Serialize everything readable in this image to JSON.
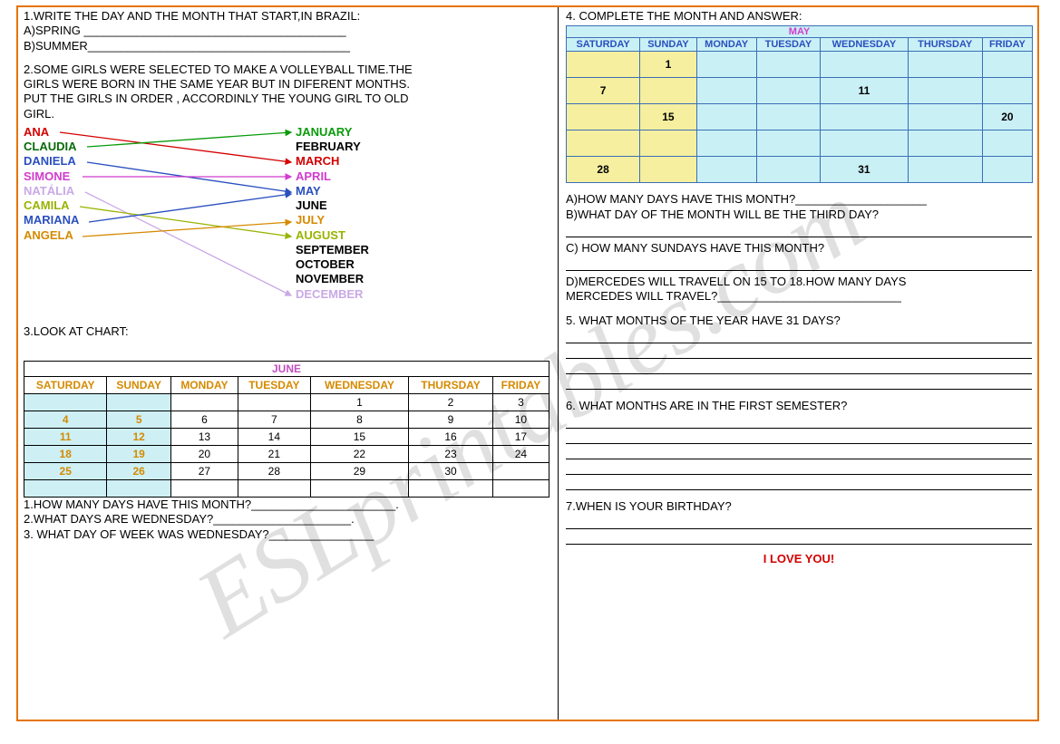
{
  "watermark": "ESLprintables.com",
  "left": {
    "q1": "1.WRITE THE DAY AND THE MONTH THAT START,IN BRAZIL:",
    "q1a": "A)SPRING ________________________________________",
    "q1b": "B)SUMMER________________________________________",
    "q2l1": "2.SOME GIRLS WERE SELECTED TO MAKE A VOLLEYBALL TIME.THE",
    "q2l2": "GIRLS WERE BORN IN THE SAME YEAR BUT IN DIFERENT MONTHS.",
    "q2l3": "PUT  THE GIRLS  IN ORDER , ACCORDINLY   THE YOUNG  GIRL TO OLD",
    "q2l4": "GIRL.",
    "names": [
      {
        "t": "ANA",
        "c": "#d40000"
      },
      {
        "t": "CLAUDIA",
        "c": "#0a6b0a"
      },
      {
        "t": "DANIELA",
        "c": "#2a4fbf"
      },
      {
        "t": "SIMONE",
        "c": "#d23ccf"
      },
      {
        "t": "NATÁLIA",
        "c": "#c9a9e6"
      },
      {
        "t": "CAMILA",
        "c": "#99b300"
      },
      {
        "t": "MARIANA",
        "c": "#2a4fbf"
      },
      {
        "t": "ANGELA",
        "c": "#d58a00"
      }
    ],
    "months12": [
      {
        "t": "JANUARY",
        "c": "#0a9b0a"
      },
      {
        "t": "FEBRUARY",
        "c": "#000"
      },
      {
        "t": "MARCH",
        "c": "#d40000"
      },
      {
        "t": "APRIL",
        "c": "#d23ccf"
      },
      {
        "t": "MAY",
        "c": "#2a4fbf"
      },
      {
        "t": "JUNE",
        "c": "#000"
      },
      {
        "t": "JULY",
        "c": "#d58a00"
      },
      {
        "t": "AUGUST",
        "c": "#99b300"
      },
      {
        "t": "SEPTEMBER",
        "c": "#000"
      },
      {
        "t": "OCTOBER",
        "c": "#000"
      },
      {
        "t": "NOVEMBER",
        "c": "#000"
      },
      {
        "t": "DECEMBER",
        "c": "#c9a9e6"
      }
    ],
    "q3": "3.LOOK AT CHART:",
    "june": {
      "title": "JUNE",
      "hdr": [
        "SATURDAY",
        "SUNDAY",
        "MONDAY",
        "TUESDAY",
        "WEDNESDAY",
        "THURSDAY",
        "FRIDAY"
      ],
      "rows": [
        [
          "",
          "",
          "",
          "",
          "1",
          "2",
          "3"
        ],
        [
          "4",
          "5",
          "6",
          "7",
          "8",
          "9",
          "10"
        ],
        [
          "11",
          "12",
          "13",
          "14",
          "15",
          "16",
          "17"
        ],
        [
          "18",
          "19",
          "20",
          "21",
          "22",
          "23",
          "24"
        ],
        [
          "25",
          "26",
          "27",
          "28",
          "29",
          "30",
          ""
        ],
        [
          "",
          "",
          "",
          "",
          "",
          "",
          ""
        ]
      ]
    },
    "q3a": "1.HOW MANY DAYS  HAVE THIS MONTH?______________________.",
    "q3b": "2.WHAT DAYS ARE WEDNESDAY?_____________________.",
    "q3c": "3. WHAT DAY OF WEEK WAS WEDNESDAY?________________"
  },
  "right": {
    "q4": "4. COMPLETE THE MONTH AND ANSWER:",
    "may": {
      "title": "MAY",
      "hdr": [
        "SATURDAY",
        "SUNDAY",
        "MONDAY",
        "TUESDAY",
        "WEDNESDAY",
        "THURSDAY",
        "FRIDAY"
      ],
      "rows": [
        [
          "",
          "1",
          "",
          "",
          "",
          "",
          ""
        ],
        [
          "7",
          "",
          "",
          "",
          "11",
          "",
          ""
        ],
        [
          "",
          "15",
          "",
          "",
          "",
          "",
          "20"
        ],
        [
          "",
          "",
          "",
          "",
          "",
          "",
          ""
        ],
        [
          "28",
          "",
          "",
          "",
          "31",
          "",
          ""
        ]
      ]
    },
    "q4a": "A)HOW MANY DAYS HAVE THIS MONTH?____________________",
    "q4b": "B)WHAT DAY OF THE MONTH WILL BE THE THIRD DAY?",
    "q4c": "C) HOW MANY SUNDAYS HAVE THIS MONTH?",
    "q4d1": "D)MERCEDES WILL TRAVELL  ON 15 TO 18.HOW MANY DAYS",
    "q4d2": "MERCEDES WILL TRAVEL?____________________________",
    "q5": "5. WHAT MONTHS OF THE YEAR HAVE 31 DAYS?",
    "q6": "6. WHAT MONTHS ARE IN THE FIRST SEMESTER?",
    "q7": "7.WHEN IS YOUR BIRTHDAY?",
    "love": "I LOVE YOU!"
  },
  "chart_data": [
    {
      "type": "table",
      "title": "JUNE",
      "columns": [
        "SATURDAY",
        "SUNDAY",
        "MONDAY",
        "TUESDAY",
        "WEDNESDAY",
        "THURSDAY",
        "FRIDAY"
      ],
      "rows": [
        [
          null,
          null,
          null,
          null,
          1,
          2,
          3
        ],
        [
          4,
          5,
          6,
          7,
          8,
          9,
          10
        ],
        [
          11,
          12,
          13,
          14,
          15,
          16,
          17
        ],
        [
          18,
          19,
          20,
          21,
          22,
          23,
          24
        ],
        [
          25,
          26,
          27,
          28,
          29,
          30,
          null
        ]
      ]
    },
    {
      "type": "table",
      "title": "MAY",
      "columns": [
        "SATURDAY",
        "SUNDAY",
        "MONDAY",
        "TUESDAY",
        "WEDNESDAY",
        "THURSDAY",
        "FRIDAY"
      ],
      "rows": [
        [
          null,
          1,
          null,
          null,
          null,
          null,
          null
        ],
        [
          7,
          null,
          null,
          null,
          11,
          null,
          null
        ],
        [
          null,
          15,
          null,
          null,
          null,
          null,
          20
        ],
        [
          null,
          null,
          null,
          null,
          null,
          null,
          null
        ],
        [
          28,
          null,
          null,
          null,
          31,
          null,
          null
        ]
      ]
    }
  ]
}
